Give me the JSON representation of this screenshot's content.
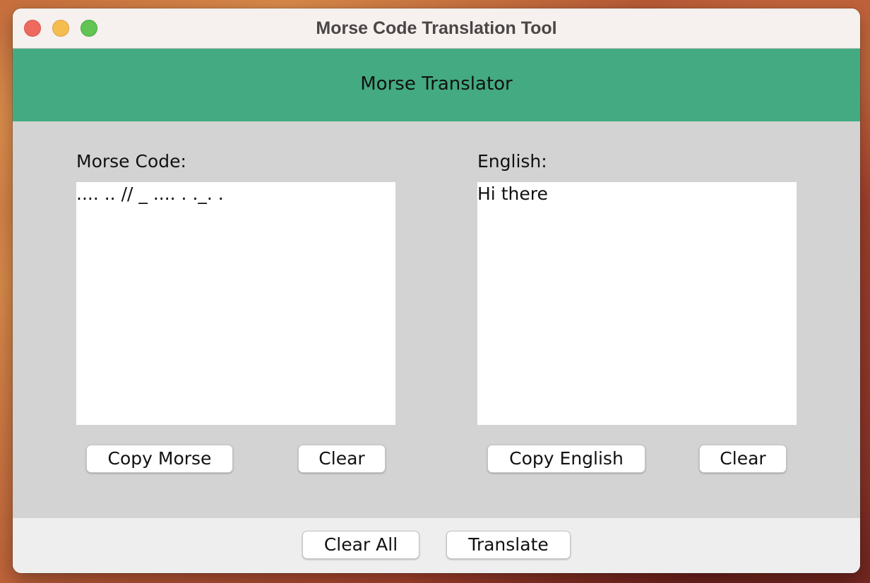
{
  "window": {
    "title": "Morse Code Translation Tool"
  },
  "header": {
    "title": "Morse Translator",
    "background_color": "#43aa82"
  },
  "morse_panel": {
    "label": "Morse Code:",
    "text": ".... .. // _ .... . ._. .",
    "copy_button": "Copy Morse",
    "clear_button": "Clear"
  },
  "english_panel": {
    "label": "English:",
    "text": "Hi there",
    "copy_button": "Copy English",
    "clear_button": "Clear"
  },
  "footer": {
    "clear_all_button": "Clear All",
    "translate_button": "Translate"
  }
}
